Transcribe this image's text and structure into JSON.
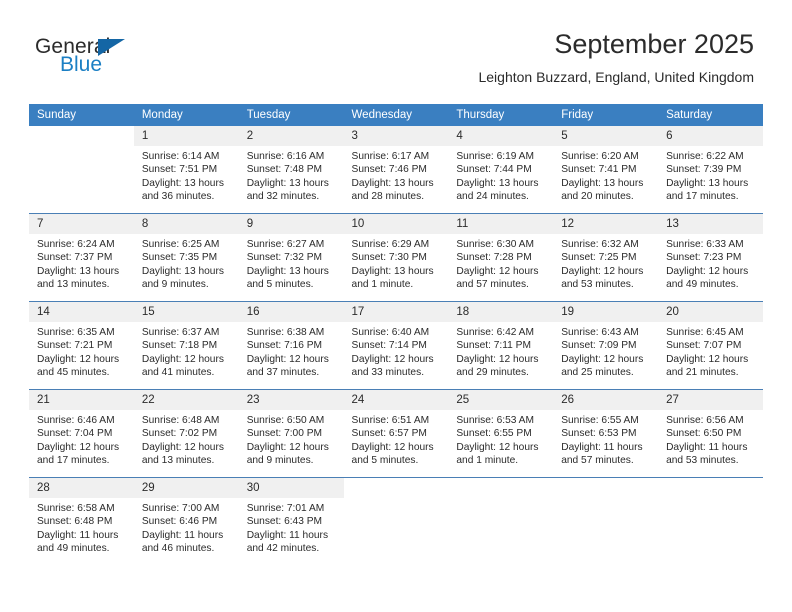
{
  "brand": {
    "word1": "General",
    "word2": "Blue",
    "accent_color": "#1b7fc4",
    "triangle_color": "#1466a5"
  },
  "header": {
    "month_title": "September 2025",
    "location": "Leighton Buzzard, England, United Kingdom",
    "header_bg": "#3a7fc1"
  },
  "calendar": {
    "weekday_headers": [
      "Sunday",
      "Monday",
      "Tuesday",
      "Wednesday",
      "Thursday",
      "Friday",
      "Saturday"
    ],
    "weeks": [
      [
        {
          "day": "",
          "sunrise": "",
          "sunset": "",
          "daylight_line1": "",
          "daylight_line2": ""
        },
        {
          "day": "1",
          "sunrise": "Sunrise: 6:14 AM",
          "sunset": "Sunset: 7:51 PM",
          "daylight_line1": "Daylight: 13 hours",
          "daylight_line2": "and 36 minutes."
        },
        {
          "day": "2",
          "sunrise": "Sunrise: 6:16 AM",
          "sunset": "Sunset: 7:48 PM",
          "daylight_line1": "Daylight: 13 hours",
          "daylight_line2": "and 32 minutes."
        },
        {
          "day": "3",
          "sunrise": "Sunrise: 6:17 AM",
          "sunset": "Sunset: 7:46 PM",
          "daylight_line1": "Daylight: 13 hours",
          "daylight_line2": "and 28 minutes."
        },
        {
          "day": "4",
          "sunrise": "Sunrise: 6:19 AM",
          "sunset": "Sunset: 7:44 PM",
          "daylight_line1": "Daylight: 13 hours",
          "daylight_line2": "and 24 minutes."
        },
        {
          "day": "5",
          "sunrise": "Sunrise: 6:20 AM",
          "sunset": "Sunset: 7:41 PM",
          "daylight_line1": "Daylight: 13 hours",
          "daylight_line2": "and 20 minutes."
        },
        {
          "day": "6",
          "sunrise": "Sunrise: 6:22 AM",
          "sunset": "Sunset: 7:39 PM",
          "daylight_line1": "Daylight: 13 hours",
          "daylight_line2": "and 17 minutes."
        }
      ],
      [
        {
          "day": "7",
          "sunrise": "Sunrise: 6:24 AM",
          "sunset": "Sunset: 7:37 PM",
          "daylight_line1": "Daylight: 13 hours",
          "daylight_line2": "and 13 minutes."
        },
        {
          "day": "8",
          "sunrise": "Sunrise: 6:25 AM",
          "sunset": "Sunset: 7:35 PM",
          "daylight_line1": "Daylight: 13 hours",
          "daylight_line2": "and 9 minutes."
        },
        {
          "day": "9",
          "sunrise": "Sunrise: 6:27 AM",
          "sunset": "Sunset: 7:32 PM",
          "daylight_line1": "Daylight: 13 hours",
          "daylight_line2": "and 5 minutes."
        },
        {
          "day": "10",
          "sunrise": "Sunrise: 6:29 AM",
          "sunset": "Sunset: 7:30 PM",
          "daylight_line1": "Daylight: 13 hours",
          "daylight_line2": "and 1 minute."
        },
        {
          "day": "11",
          "sunrise": "Sunrise: 6:30 AM",
          "sunset": "Sunset: 7:28 PM",
          "daylight_line1": "Daylight: 12 hours",
          "daylight_line2": "and 57 minutes."
        },
        {
          "day": "12",
          "sunrise": "Sunrise: 6:32 AM",
          "sunset": "Sunset: 7:25 PM",
          "daylight_line1": "Daylight: 12 hours",
          "daylight_line2": "and 53 minutes."
        },
        {
          "day": "13",
          "sunrise": "Sunrise: 6:33 AM",
          "sunset": "Sunset: 7:23 PM",
          "daylight_line1": "Daylight: 12 hours",
          "daylight_line2": "and 49 minutes."
        }
      ],
      [
        {
          "day": "14",
          "sunrise": "Sunrise: 6:35 AM",
          "sunset": "Sunset: 7:21 PM",
          "daylight_line1": "Daylight: 12 hours",
          "daylight_line2": "and 45 minutes."
        },
        {
          "day": "15",
          "sunrise": "Sunrise: 6:37 AM",
          "sunset": "Sunset: 7:18 PM",
          "daylight_line1": "Daylight: 12 hours",
          "daylight_line2": "and 41 minutes."
        },
        {
          "day": "16",
          "sunrise": "Sunrise: 6:38 AM",
          "sunset": "Sunset: 7:16 PM",
          "daylight_line1": "Daylight: 12 hours",
          "daylight_line2": "and 37 minutes."
        },
        {
          "day": "17",
          "sunrise": "Sunrise: 6:40 AM",
          "sunset": "Sunset: 7:14 PM",
          "daylight_line1": "Daylight: 12 hours",
          "daylight_line2": "and 33 minutes."
        },
        {
          "day": "18",
          "sunrise": "Sunrise: 6:42 AM",
          "sunset": "Sunset: 7:11 PM",
          "daylight_line1": "Daylight: 12 hours",
          "daylight_line2": "and 29 minutes."
        },
        {
          "day": "19",
          "sunrise": "Sunrise: 6:43 AM",
          "sunset": "Sunset: 7:09 PM",
          "daylight_line1": "Daylight: 12 hours",
          "daylight_line2": "and 25 minutes."
        },
        {
          "day": "20",
          "sunrise": "Sunrise: 6:45 AM",
          "sunset": "Sunset: 7:07 PM",
          "daylight_line1": "Daylight: 12 hours",
          "daylight_line2": "and 21 minutes."
        }
      ],
      [
        {
          "day": "21",
          "sunrise": "Sunrise: 6:46 AM",
          "sunset": "Sunset: 7:04 PM",
          "daylight_line1": "Daylight: 12 hours",
          "daylight_line2": "and 17 minutes."
        },
        {
          "day": "22",
          "sunrise": "Sunrise: 6:48 AM",
          "sunset": "Sunset: 7:02 PM",
          "daylight_line1": "Daylight: 12 hours",
          "daylight_line2": "and 13 minutes."
        },
        {
          "day": "23",
          "sunrise": "Sunrise: 6:50 AM",
          "sunset": "Sunset: 7:00 PM",
          "daylight_line1": "Daylight: 12 hours",
          "daylight_line2": "and 9 minutes."
        },
        {
          "day": "24",
          "sunrise": "Sunrise: 6:51 AM",
          "sunset": "Sunset: 6:57 PM",
          "daylight_line1": "Daylight: 12 hours",
          "daylight_line2": "and 5 minutes."
        },
        {
          "day": "25",
          "sunrise": "Sunrise: 6:53 AM",
          "sunset": "Sunset: 6:55 PM",
          "daylight_line1": "Daylight: 12 hours",
          "daylight_line2": "and 1 minute."
        },
        {
          "day": "26",
          "sunrise": "Sunrise: 6:55 AM",
          "sunset": "Sunset: 6:53 PM",
          "daylight_line1": "Daylight: 11 hours",
          "daylight_line2": "and 57 minutes."
        },
        {
          "day": "27",
          "sunrise": "Sunrise: 6:56 AM",
          "sunset": "Sunset: 6:50 PM",
          "daylight_line1": "Daylight: 11 hours",
          "daylight_line2": "and 53 minutes."
        }
      ],
      [
        {
          "day": "28",
          "sunrise": "Sunrise: 6:58 AM",
          "sunset": "Sunset: 6:48 PM",
          "daylight_line1": "Daylight: 11 hours",
          "daylight_line2": "and 49 minutes."
        },
        {
          "day": "29",
          "sunrise": "Sunrise: 7:00 AM",
          "sunset": "Sunset: 6:46 PM",
          "daylight_line1": "Daylight: 11 hours",
          "daylight_line2": "and 46 minutes."
        },
        {
          "day": "30",
          "sunrise": "Sunrise: 7:01 AM",
          "sunset": "Sunset: 6:43 PM",
          "daylight_line1": "Daylight: 11 hours",
          "daylight_line2": "and 42 minutes."
        },
        {
          "day": "",
          "sunrise": "",
          "sunset": "",
          "daylight_line1": "",
          "daylight_line2": ""
        },
        {
          "day": "",
          "sunrise": "",
          "sunset": "",
          "daylight_line1": "",
          "daylight_line2": ""
        },
        {
          "day": "",
          "sunrise": "",
          "sunset": "",
          "daylight_line1": "",
          "daylight_line2": ""
        },
        {
          "day": "",
          "sunrise": "",
          "sunset": "",
          "daylight_line1": "",
          "daylight_line2": ""
        }
      ]
    ]
  }
}
